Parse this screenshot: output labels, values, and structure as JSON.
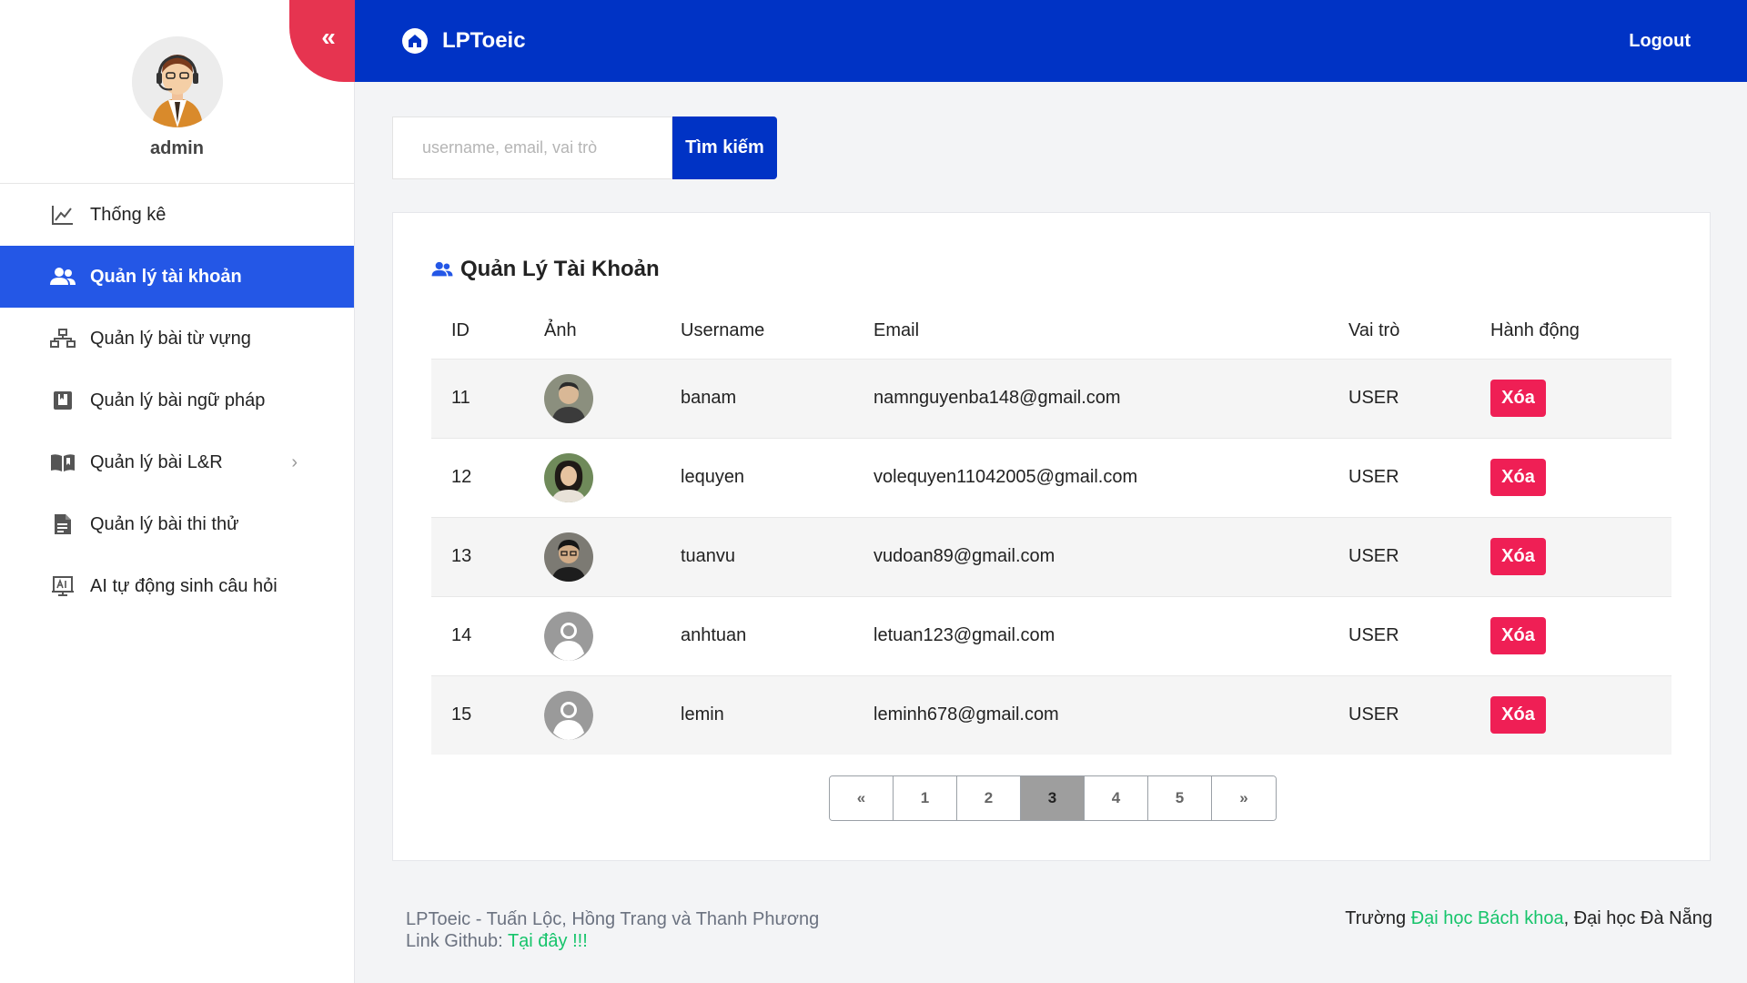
{
  "sidebar": {
    "user_name": "admin",
    "collapse_glyph": "«",
    "items": [
      {
        "label": "Thống kê",
        "icon": "chart-line-icon",
        "active": false
      },
      {
        "label": "Quản lý tài khoản",
        "icon": "users-icon",
        "active": true
      },
      {
        "label": "Quản lý bài từ vựng",
        "icon": "sitemap-icon",
        "active": false
      },
      {
        "label": "Quản lý bài ngữ pháp",
        "icon": "book-square-icon",
        "active": false
      },
      {
        "label": "Quản lý bài L&R",
        "icon": "open-book-icon",
        "active": false,
        "has_submenu": true
      },
      {
        "label": "Quản lý bài thi thử",
        "icon": "document-icon",
        "active": false
      },
      {
        "label": "AI tự động sinh câu hỏi",
        "icon": "ai-board-icon",
        "active": false
      }
    ]
  },
  "header": {
    "brand": "LPToeic",
    "logout_label": "Logout",
    "background": "#0033c5"
  },
  "search": {
    "placeholder": "username, email, vai trò",
    "value": "",
    "button_label": "Tìm kiếm"
  },
  "accounts": {
    "title": "Quản Lý Tài Khoản",
    "columns": [
      "ID",
      "Ảnh",
      "Username",
      "Email",
      "Vai trò",
      "Hành động"
    ],
    "rows": [
      {
        "id": "11",
        "avatar": "photo-avatar",
        "username": "banam",
        "email": "namnguyenba148@gmail.com",
        "role": "USER",
        "action": "Xóa"
      },
      {
        "id": "12",
        "avatar": "photo-avatar",
        "username": "lequyen",
        "email": "volequyen11042005@gmail.com",
        "role": "USER",
        "action": "Xóa"
      },
      {
        "id": "13",
        "avatar": "photo-avatar",
        "username": "tuanvu",
        "email": "vudoan89@gmail.com",
        "role": "USER",
        "action": "Xóa"
      },
      {
        "id": "14",
        "avatar": "default-avatar",
        "username": "anhtuan",
        "email": "letuan123@gmail.com",
        "role": "USER",
        "action": "Xóa"
      },
      {
        "id": "15",
        "avatar": "default-avatar",
        "username": "lemin",
        "email": "leminh678@gmail.com",
        "role": "USER",
        "action": "Xóa"
      }
    ]
  },
  "pagination": {
    "prev": "«",
    "pages": [
      "1",
      "2",
      "3",
      "4",
      "5"
    ],
    "current": "3",
    "next": "»"
  },
  "footer": {
    "credits": "LPToeic - Tuấn Lộc, Hồng Trang và Thanh Phương",
    "github_prefix": "Link Github: ",
    "github_link": "Tại đây !!!",
    "school_prefix": "Trường ",
    "school_link": "Đại học Bách khoa",
    "school_suffix": ", Đại học Đà Nẵng"
  },
  "colors": {
    "accent_blue": "#2457e6",
    "delete_red": "#ef1f55",
    "collapse_red": "#e63450",
    "link_green": "#16c46b"
  }
}
